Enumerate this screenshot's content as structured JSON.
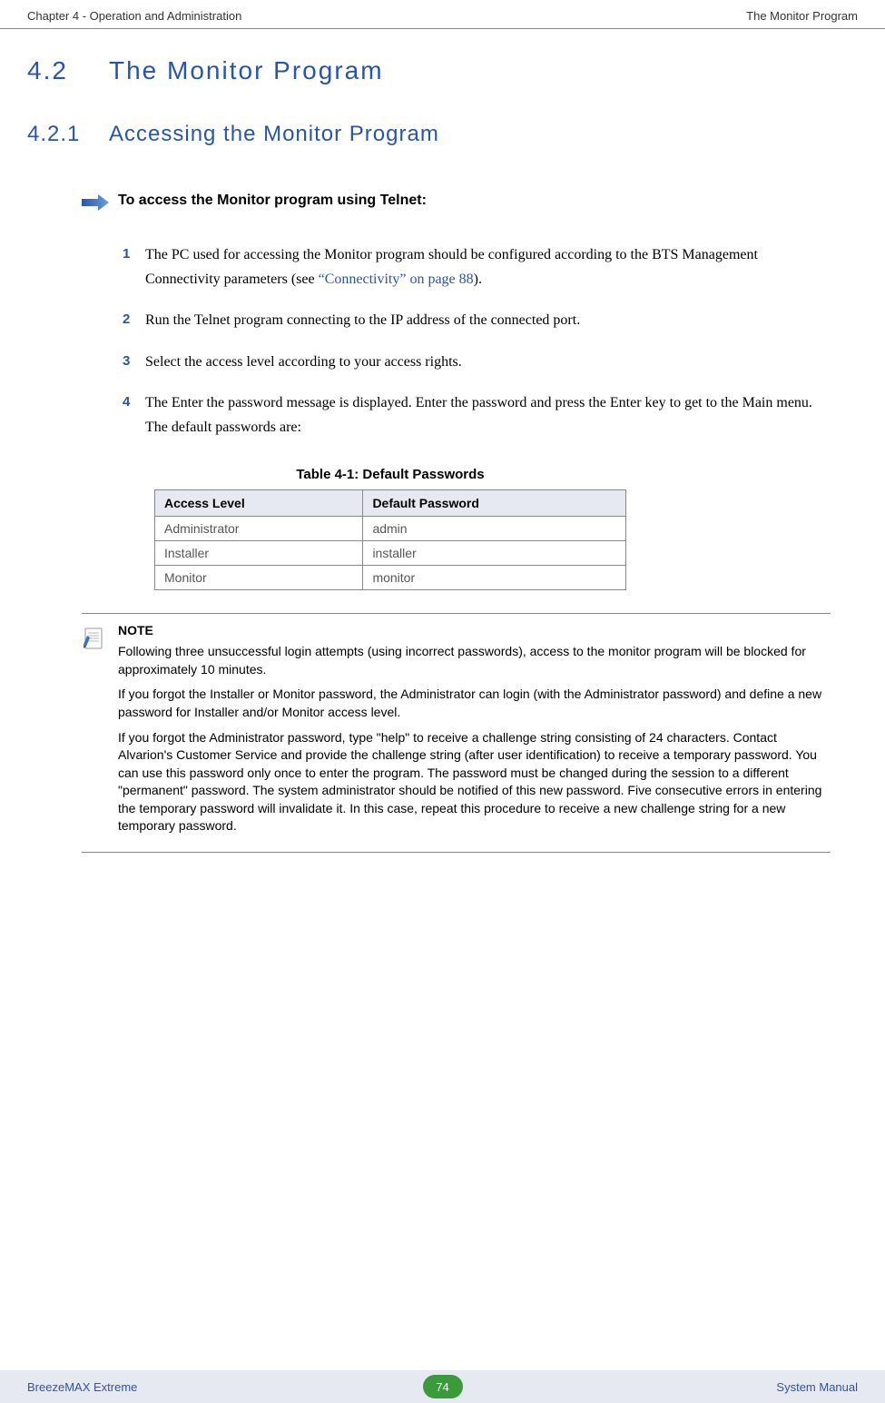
{
  "header": {
    "left": "Chapter 4 - Operation and Administration",
    "right": "The Monitor Program"
  },
  "section": {
    "number": "4.2",
    "title": "The Monitor Program"
  },
  "subsection": {
    "number": "4.2.1",
    "title": "Accessing the Monitor Program"
  },
  "procedure_intro": "To access the Monitor program using Telnet:",
  "steps": {
    "s1_num": "1",
    "s1a": "The PC used for accessing the Monitor program should be configured according to the BTS Management Connectivity parameters (see ",
    "s1_link": "“Connectivity” on page 88",
    "s1b": ").",
    "s2_num": "2",
    "s2": "Run the Telnet program connecting to the IP address of the connected port.",
    "s3_num": "3",
    "s3": "Select the access level according to your access rights.",
    "s4_num": "4",
    "s4": "The Enter the password message is displayed. Enter the password and press the Enter key to get to the Main menu. The default passwords are:"
  },
  "table": {
    "caption": "Table 4-1: Default Passwords",
    "headers": {
      "col1": "Access Level",
      "col2": "Default Password"
    },
    "rows": {
      "r1c1": "Administrator",
      "r1c2": "admin",
      "r2c1": "Installer",
      "r2c2": "installer",
      "r3c1": "Monitor",
      "r3c2": "monitor"
    }
  },
  "note": {
    "title": "NOTE",
    "p1": "Following three unsuccessful login attempts (using incorrect passwords), access to the monitor program will be blocked for approximately 10 minutes.",
    "p2": "If you forgot the Installer or Monitor password, the Administrator can login (with the Administrator password) and define a new password for Installer and/or Monitor access level.",
    "p3": "If you forgot the Administrator password, type \"help\" to receive a challenge string consisting of 24 characters. Contact Alvarion's Customer Service and provide the challenge string (after user identification) to receive a temporary password. You can use this password only once to enter the program. The password must be changed during the session to a different \"permanent\" password. The system administrator should be notified of this new password. Five consecutive errors in entering the temporary password will invalidate it. In this case, repeat this procedure to receive a new challenge string for a new temporary password."
  },
  "footer": {
    "left": "BreezeMAX Extreme",
    "page": "74",
    "right": "System Manual"
  }
}
